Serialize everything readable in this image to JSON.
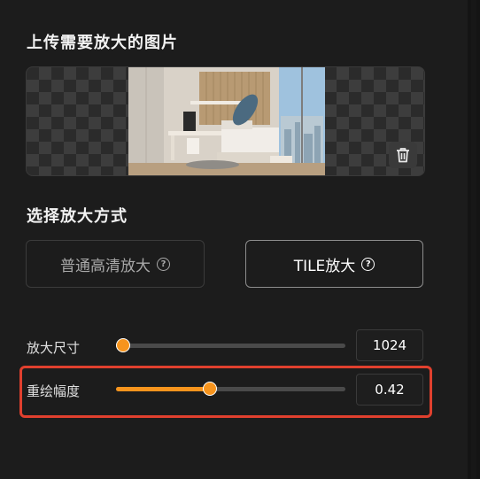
{
  "upload": {
    "title": "上传需要放大的图片",
    "preview_alt": "bedroom interior photo",
    "trash_icon": "trash-icon"
  },
  "method": {
    "title": "选择放大方式",
    "options": [
      {
        "label": "普通高清放大",
        "selected": false,
        "help_icon": "help-icon"
      },
      {
        "label": "TILE放大",
        "selected": true,
        "help_icon": "help-icon"
      }
    ]
  },
  "sliders": {
    "size": {
      "label": "放大尺寸",
      "value": "1024",
      "fraction": 0.03
    },
    "strength": {
      "label": "重绘幅度",
      "value": "0.42",
      "fraction": 0.41
    }
  },
  "colors": {
    "accent": "#f7941d",
    "highlight": "#e0402e",
    "background": "#1c1c1c"
  }
}
